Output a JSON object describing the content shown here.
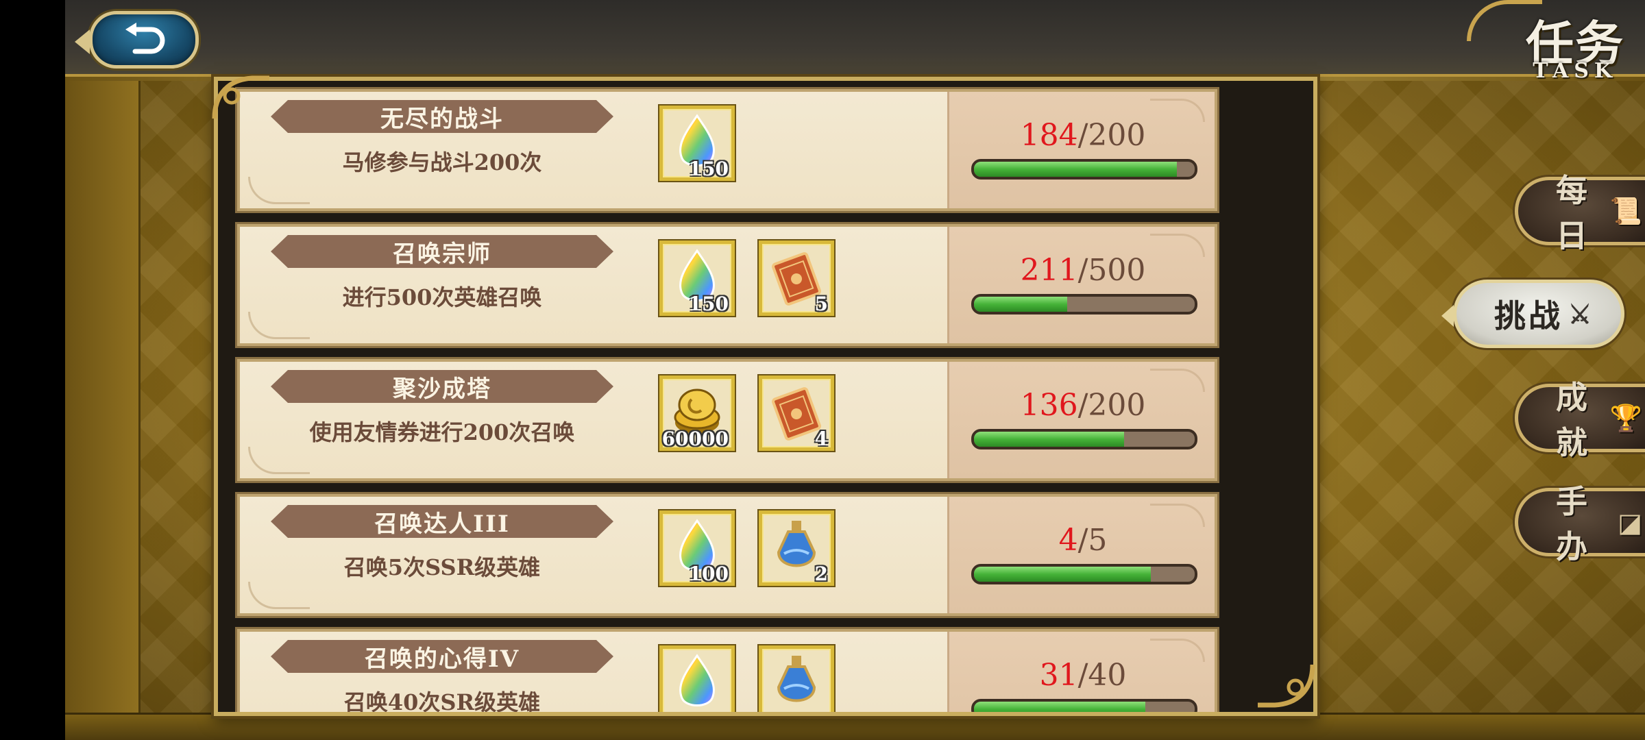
{
  "header": {
    "title_zh": "任务",
    "title_en": "TASK"
  },
  "tasks": [
    {
      "title": "无尽的战斗",
      "desc": "马修参与战斗200次",
      "rewards": [
        {
          "icon": "rainbow-crystal-icon",
          "count": "150"
        }
      ],
      "current": "184",
      "total": "/200",
      "progress": 0.92
    },
    {
      "title": "召唤宗师",
      "desc": "进行500次英雄召唤",
      "rewards": [
        {
          "icon": "rainbow-crystal-icon",
          "count": "150"
        },
        {
          "icon": "summon-ticket-icon",
          "count": "5"
        }
      ],
      "current": "211",
      "total": "/500",
      "progress": 0.422
    },
    {
      "title": "聚沙成塔",
      "desc": "使用友情券进行200次召唤",
      "rewards": [
        {
          "icon": "gold-coin-icon",
          "count": "60000"
        },
        {
          "icon": "summon-ticket-icon",
          "count": "4"
        }
      ],
      "current": "136",
      "total": "/200",
      "progress": 0.68
    },
    {
      "title": "召唤达人III",
      "desc": "召唤5次SSR级英雄",
      "rewards": [
        {
          "icon": "rainbow-crystal-icon",
          "count": "100"
        },
        {
          "icon": "blue-potion-icon",
          "count": "2"
        }
      ],
      "current": "4",
      "total": "/5",
      "progress": 0.8
    },
    {
      "title": "召唤的心得IV",
      "desc": "召唤40次SR级英雄",
      "rewards": [
        {
          "icon": "rainbow-crystal-icon",
          "count": ""
        },
        {
          "icon": "blue-potion-icon",
          "count": ""
        }
      ],
      "current": "31",
      "total": "/40",
      "progress": 0.775
    }
  ],
  "tabs": [
    {
      "label": "每日",
      "icon": "scroll-icon",
      "active": false
    },
    {
      "label": "挑战",
      "icon": "crossed-swords-icon",
      "active": true
    },
    {
      "label": "成就",
      "icon": "trophy-icon",
      "active": false
    },
    {
      "label": "手办",
      "icon": "figure-box-icon",
      "active": false
    }
  ],
  "colors": {
    "progress_current": "#e0171d",
    "progress_fill": "#46b339",
    "panel_border": "#c9ad5f"
  }
}
